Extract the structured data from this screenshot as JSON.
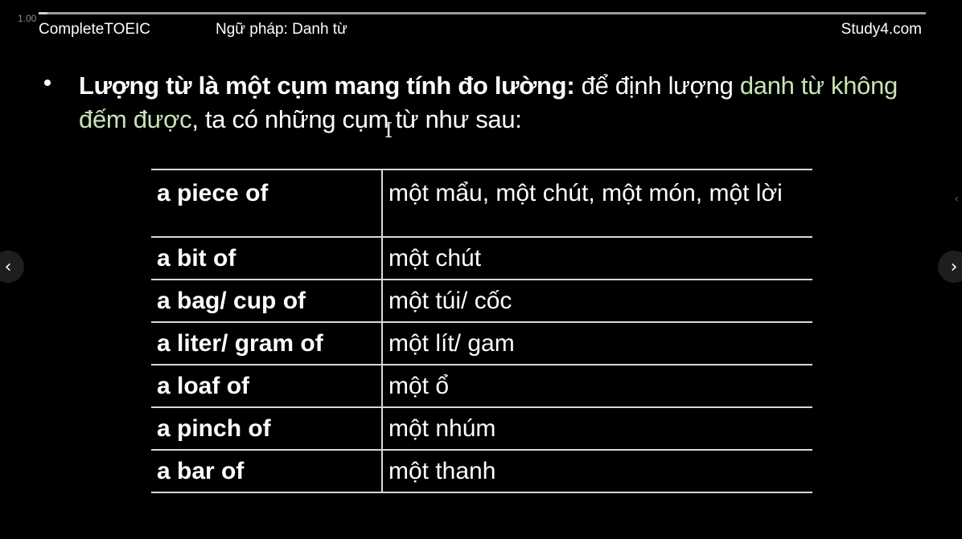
{
  "player": {
    "speed_label": "1.00",
    "progress": 0.01
  },
  "header": {
    "left": "CompleteTOEIC",
    "middle": "Ngữ pháp: Danh từ",
    "right": "Study4.com"
  },
  "bullet": {
    "bold": "Lượng từ là một cụm mang tính đo lường:",
    "normal_1": " để định lượng ",
    "highlight": "danh từ không đếm được",
    "normal_2": ", ta có những cụm từ như sau:"
  },
  "table": {
    "rows": [
      {
        "en": "a piece of",
        "vi": "một mẩu, một chút, một món, một lời"
      },
      {
        "en": "a bit of",
        "vi": "một chút"
      },
      {
        "en": "a bag/ cup of",
        "vi": "một túi/ cốc"
      },
      {
        "en": "a liter/ gram of",
        "vi": "một lít/ gam"
      },
      {
        "en": "a loaf of",
        "vi": "một ổ"
      },
      {
        "en": "a pinch of",
        "vi": "một nhúm"
      },
      {
        "en": "a bar of",
        "vi": "một thanh"
      }
    ]
  },
  "icons": {
    "prev": "chevron-left-icon",
    "next": "chevron-right-icon",
    "cursor": "text-cursor-icon"
  }
}
